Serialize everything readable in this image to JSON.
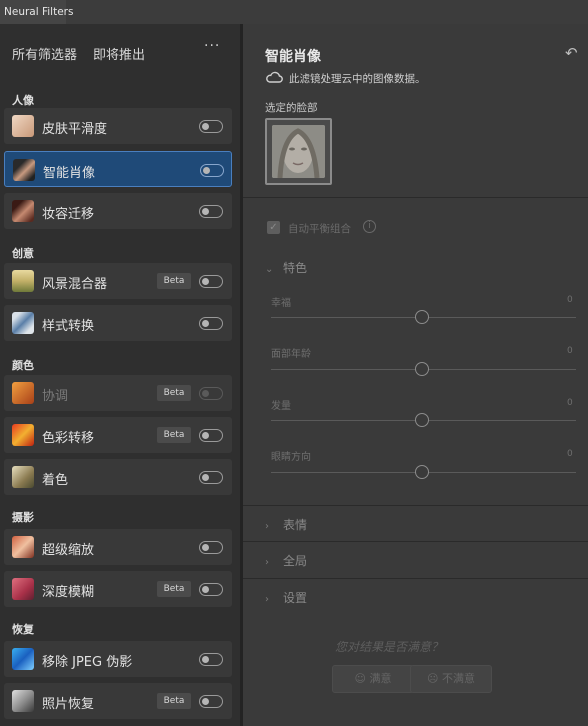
{
  "window": {
    "tab_title": "Neural Filters"
  },
  "left": {
    "header_all": "所有筛选器",
    "header_soon": "即将推出",
    "more": "···",
    "categories": [
      {
        "label": "人像"
      },
      {
        "label": "创意"
      },
      {
        "label": "颜色"
      },
      {
        "label": "摄影"
      },
      {
        "label": "恢复"
      }
    ],
    "filters": [
      {
        "label": "皮肤平滑度",
        "beta": ""
      },
      {
        "label": "智能肖像",
        "beta": ""
      },
      {
        "label": "妆容迁移",
        "beta": ""
      },
      {
        "label": "风景混合器",
        "beta": "Beta"
      },
      {
        "label": "样式转换",
        "beta": ""
      },
      {
        "label": "协调",
        "beta": "Beta"
      },
      {
        "label": "色彩转移",
        "beta": "Beta"
      },
      {
        "label": "着色",
        "beta": ""
      },
      {
        "label": "超级缩放",
        "beta": ""
      },
      {
        "label": "深度模糊",
        "beta": "Beta"
      },
      {
        "label": "移除 JPEG 伪影",
        "beta": ""
      },
      {
        "label": "照片恢复",
        "beta": "Beta"
      }
    ]
  },
  "right": {
    "title": "智能肖像",
    "cloud_note": "此滤镜处理云中的图像数据。",
    "selected_face_label": "选定的脸部",
    "auto_balance_label": "自动平衡组合",
    "sections": {
      "features": "特色",
      "expression": "表情",
      "global": "全局",
      "settings": "设置"
    },
    "sliders": [
      {
        "label": "幸福",
        "value": "0"
      },
      {
        "label": "面部年龄",
        "value": "0"
      },
      {
        "label": "发量",
        "value": "0"
      },
      {
        "label": "眼睛方向",
        "value": "0"
      }
    ],
    "feedback": {
      "question": "您对结果是否满意？",
      "yes": "满意",
      "no": "不满意"
    }
  }
}
